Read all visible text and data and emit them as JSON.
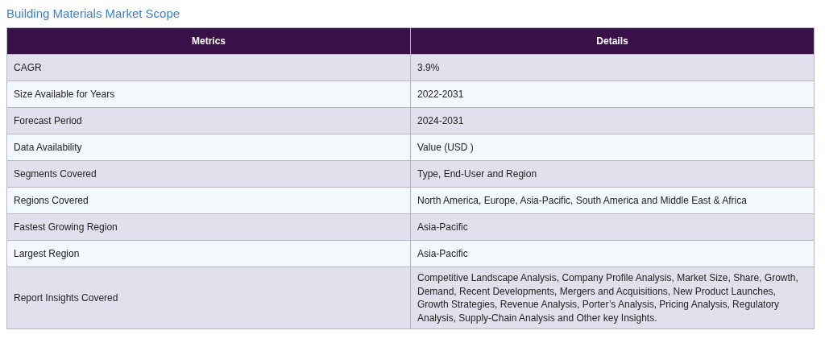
{
  "title": "Building Materials Market Scope",
  "table": {
    "columns": [
      "Metrics",
      "Details"
    ],
    "rows": [
      [
        "CAGR",
        "3.9%"
      ],
      [
        "Size Available for Years",
        "2022-2031"
      ],
      [
        "Forecast Period",
        "2024-2031"
      ],
      [
        "Data Availability",
        "Value (USD )"
      ],
      [
        "Segments Covered",
        "Type, End-User and Region"
      ],
      [
        "Regions Covered",
        "North America, Europe, Asia-Pacific, South America and Middle East & Africa"
      ],
      [
        "Fastest Growing Region",
        "Asia-Pacific"
      ],
      [
        "Largest Region",
        "Asia-Pacific"
      ],
      [
        "Report Insights Covered",
        "Competitive Landscape Analysis, Company Profile Analysis, Market Size, Share, Growth, Demand, Recent Developments, Mergers and Acquisitions, New Product Launches, Growth Strategies, Revenue Analysis, Porter’s Analysis, Pricing Analysis, Regulatory Analysis, Supply-Chain Analysis and Other key Insights."
      ]
    ]
  }
}
